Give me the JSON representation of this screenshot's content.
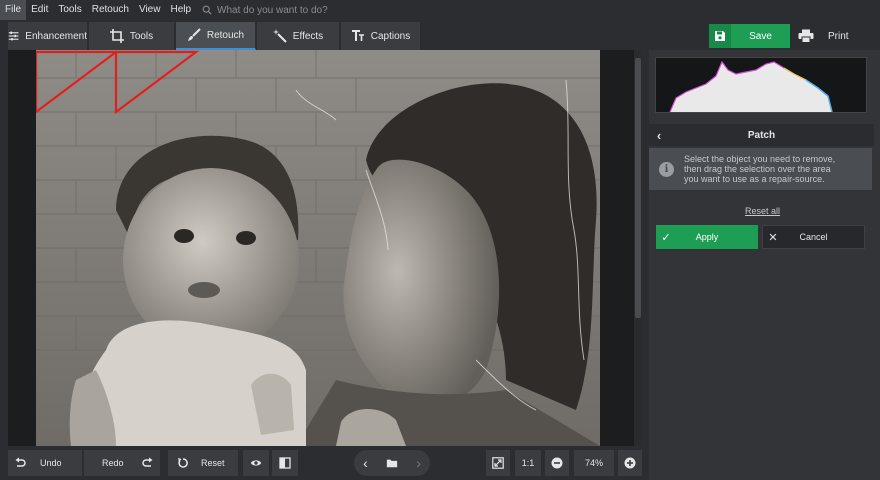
{
  "menu": {
    "items": [
      "File",
      "Edit",
      "Tools",
      "Retouch",
      "View",
      "Help"
    ],
    "search_placeholder": "What do you want to do?"
  },
  "tabs": {
    "enhancement": "Enhancement",
    "tools": "Tools",
    "retouch": "Retouch",
    "effects": "Effects",
    "captions": "Captions"
  },
  "toolbar": {
    "save_label": "Save",
    "print_label": "Print"
  },
  "panel": {
    "title": "Patch",
    "info_lines": [
      "Select the object you need to remove,",
      "then drag the selection over the area",
      "you want to use as a repair-source."
    ],
    "reset_all": "Reset all",
    "apply_label": "Apply",
    "cancel_label": "Cancel"
  },
  "bottom": {
    "undo_label": "Undo",
    "redo_label": "Redo",
    "reset_label": "Reset",
    "ratio_label": "1:1",
    "zoom": "74%"
  },
  "colors": {
    "accent_green": "#1e9e55",
    "active_tab_underline": "#3d8fd6",
    "selection_red": "#e0201f"
  },
  "icons": [
    "search-icon",
    "sliders-icon",
    "crop-icon",
    "brush-icon",
    "magic-wand-icon",
    "text-icon",
    "save-icon",
    "printer-icon",
    "back-chevron-icon",
    "info-icon",
    "check-icon",
    "close-icon",
    "undo-icon",
    "redo-icon",
    "reset-icon",
    "eye-icon",
    "compare-icon",
    "chevron-left-icon",
    "folder-icon",
    "chevron-right-icon",
    "fit-screen-icon",
    "zoom-out-icon",
    "zoom-in-icon"
  ]
}
